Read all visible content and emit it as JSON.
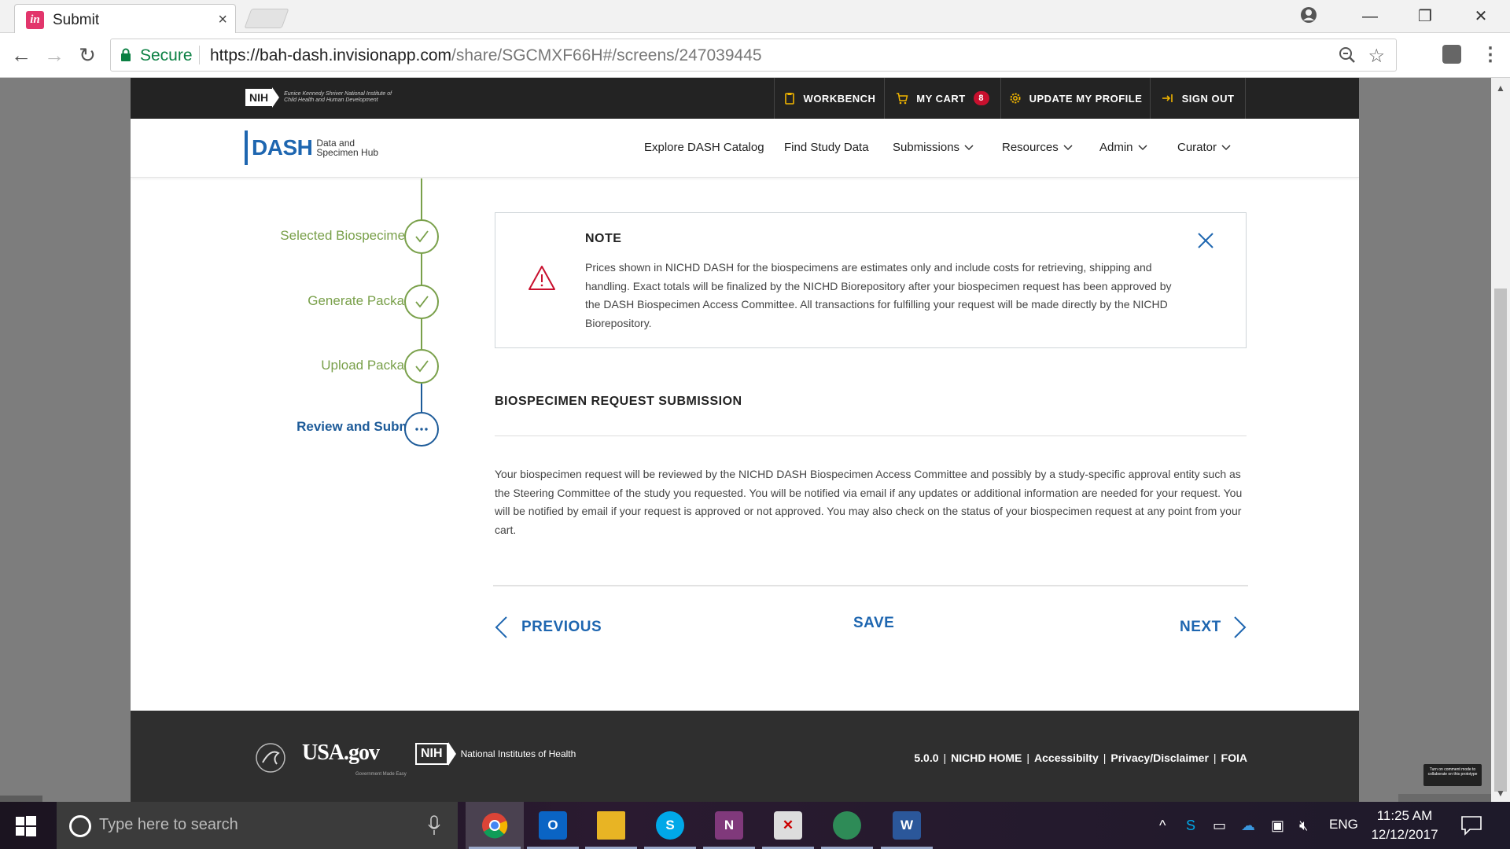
{
  "browser": {
    "tab_title": "Submit",
    "tab_close": "×",
    "secure_label": "Secure",
    "url_host": "https://bah-dash.invisionapp.com",
    "url_path": "/share/SGCMXF66H#/screens/247039445"
  },
  "utility": {
    "nih_badge": "NIH",
    "nih_text": "Eunice Kennedy Shriver National Institute of Child Health and Human Development",
    "workbench": "WORKBENCH",
    "my_cart": "MY CART",
    "cart_count": "8",
    "update_profile": "UPDATE MY PROFILE",
    "sign_out": "SIGN OUT"
  },
  "nav": {
    "logo_word": "DASH",
    "logo_line1": "Data and",
    "logo_line2": "Specimen Hub",
    "items": [
      "Explore DASH Catalog",
      "Find Study Data",
      "Submissions",
      "Resources",
      "Admin",
      "Curator"
    ]
  },
  "stepper": {
    "steps": [
      {
        "label": "Selected Biospecimens",
        "status": "complete"
      },
      {
        "label": "Generate Package",
        "status": "complete"
      },
      {
        "label": "Upload Package",
        "status": "complete"
      },
      {
        "label": "Review and Submit",
        "status": "current"
      }
    ],
    "check": "✓",
    "ellipsis": "..."
  },
  "note": {
    "title": "NOTE",
    "body": "Prices shown in NICHD DASH for the biospecimens are estimates only and include costs for retrieving, shipping and handling.  Exact totals will be finalized by the NICHD Biorepository after your biospecimen request has been approved by the DASH Biospecimen Access Committee. All transactions for fulfilling your request will be made directly by the NICHD Biorepository."
  },
  "submission": {
    "title": "BIOSPECIMEN REQUEST SUBMISSION",
    "body": "Your biospecimen request will be reviewed by the NICHD DASH Biospecimen Access Committee and possibly by a study-specific approval entity such as the Steering Committee of the study you requested. You will be notified via email if any updates or additional information are needed for your request. You will be notified by email if your request is approved or not approved. You may also check on the status of your biospecimen request at any point from your cart."
  },
  "actions": {
    "previous": "PREVIOUS",
    "save": "SAVE",
    "next": "NEXT"
  },
  "footer": {
    "usa_gov": "USA.gov",
    "usa_gov_tag": "Government Made Easy",
    "nih_badge": "NIH",
    "nih_text": "National Institutes of Health",
    "links": [
      "5.0.0",
      "NICHD HOME",
      "Accessibilty",
      "Privacy/Disclaimer",
      "FOIA"
    ]
  },
  "invision": {
    "collab_tip": "Turn on comment mode to collaborate on this prototype"
  },
  "taskbar": {
    "search_placeholder": "Type here to search",
    "lang": "ENG",
    "time": "11:25 AM",
    "date": "12/12/2017"
  },
  "colors": {
    "primary_blue": "#1e66b0",
    "step_green": "#79a04a",
    "current_navy": "#1d5b99",
    "warning_red": "#c8102e"
  }
}
